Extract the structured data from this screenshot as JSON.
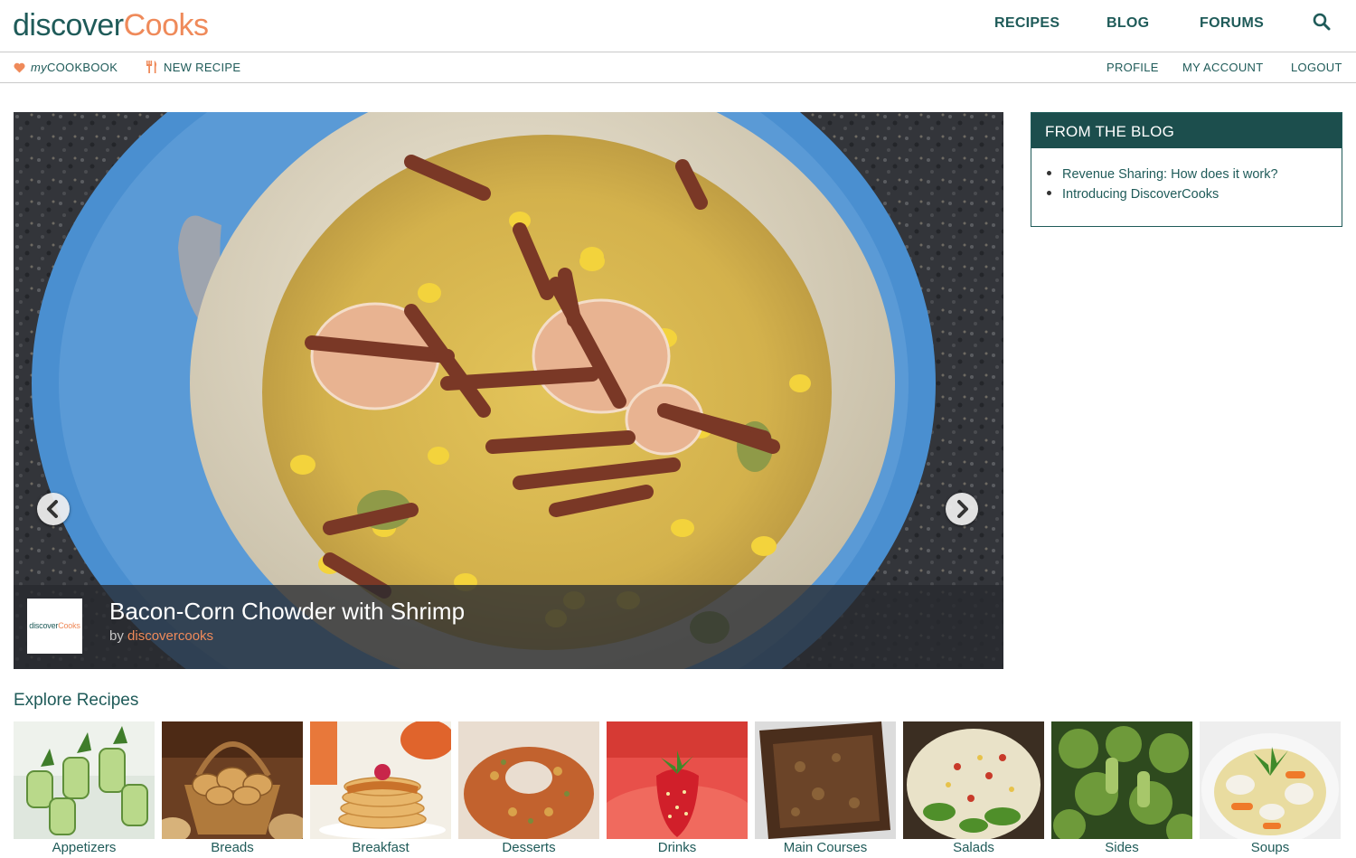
{
  "brand": {
    "part1": "discover",
    "part2": "Cooks"
  },
  "main_nav": {
    "recipes": "RECIPES",
    "blog": "BLOG",
    "forums": "FORUMS"
  },
  "sub_nav": {
    "cookbook_prefix": "my",
    "cookbook_label": "COOKBOOK",
    "new_recipe": "NEW RECIPE",
    "profile": "PROFILE",
    "my_account": "MY ACCOUNT",
    "logout": "LOGOUT"
  },
  "hero": {
    "title": "Bacon-Corn Chowder with Shrimp",
    "by_prefix": "by",
    "author": "discovercooks",
    "author_thumb_part1": "discover",
    "author_thumb_part2": "Cooks"
  },
  "blog": {
    "heading": "FROM THE BLOG",
    "posts": [
      "Revenue Sharing: How does it work?",
      "Introducing DiscoverCooks"
    ]
  },
  "explore": {
    "heading": "Explore Recipes",
    "categories": [
      "Appetizers",
      "Breads",
      "Breakfast",
      "Desserts",
      "Drinks",
      "Main Courses",
      "Salads",
      "Sides",
      "Soups"
    ]
  },
  "colors": {
    "brand_teal": "#1f5b59",
    "brand_orange": "#ef8a5a",
    "blog_header": "#1c4e4d"
  },
  "icons": {
    "search": "search-icon",
    "heart": "heart-icon",
    "fork_knife": "fork-knife-icon",
    "prev": "chevron-left-icon",
    "next": "chevron-right-icon"
  }
}
